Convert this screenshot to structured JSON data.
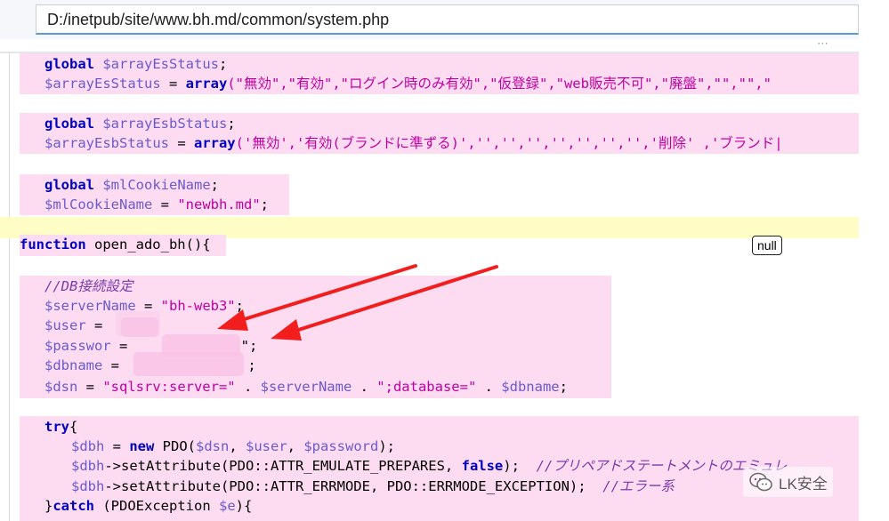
{
  "address_bar": {
    "path": "D:/inetpub/site/www.bh.md/common/system.php"
  },
  "toolbar": {
    "more_dots": "⋯"
  },
  "tooltip": {
    "value": "null"
  },
  "watermark": {
    "text": "LK安全",
    "icon": "wechat-icon"
  },
  "code": {
    "l1": {
      "kw": "global",
      "var": "$arrayEsStatus",
      "tail": ";"
    },
    "l2": {
      "var": "$arrayEsStatus",
      "op": " = ",
      "kw": "array",
      "rest": "(\"無効\",\"有効\",\"ログイン時のみ有効\",\"仮登録\",\"web販売不可\",\"廃盤\",\"\",\"\",\""
    },
    "l3": {
      "kw": "global",
      "var": "$arrayEsbStatus",
      "tail": ";"
    },
    "l4": {
      "var": "$arrayEsbStatus",
      "op": " = ",
      "kw": "array",
      "rest": "('無効','有効(ブランドに準ずる)','','','','','','','','削除' ,'ブランド|"
    },
    "l5": {
      "kw": "global",
      "var": "$mlCookieName",
      "tail": ";"
    },
    "l6": {
      "var": "$mlCookieName",
      "op": " = ",
      "str": "\"newbh.md\"",
      "tail": ";"
    },
    "l7": {
      "kw": "function",
      "name": " open_ado_bh(){"
    },
    "l8": {
      "comment": "//DB接続設定"
    },
    "l9": {
      "var": "$serverName",
      "op": " = ",
      "str": "\"bh-web3\"",
      "tail": ";"
    },
    "l10": {
      "var": "$user",
      "op": " = "
    },
    "l11": {
      "var": "$passwor",
      "op": " = ",
      "tail": "\";"
    },
    "l12": {
      "var": "$dbname",
      "op": " = ",
      "tail": ";"
    },
    "l13": {
      "var1": "$dsn",
      "op1": " = ",
      "str1": "\"sqlsrv:server=\"",
      "op2": " . ",
      "var2": "$serverName",
      "op3": " . ",
      "str2": "\";database=\"",
      "op4": " . ",
      "var3": "$dbname",
      "tail": ";"
    },
    "l14": {
      "kw": "try",
      "tail": "{"
    },
    "l15": {
      "var1": "$dbh",
      "op": " = ",
      "kw": "new",
      "mid": " PDO(",
      "var2": "$dsn",
      "c1": ", ",
      "var3": "$user",
      "c2": ", ",
      "var4": "$password",
      "tail": ");"
    },
    "l16": {
      "var": "$dbh",
      "call": "->setAttribute(PDO::ATTR_EMULATE_PREPARES, ",
      "kw": "false",
      "tail": ");  ",
      "comment": "//プリペアドステートメントのエミュレ"
    },
    "l17": {
      "var": "$dbh",
      "call": "->setAttribute(PDO::ATTR_ERRMODE, PDO::ERRMODE_EXCEPTION);  ",
      "comment": "//エラー系"
    },
    "l18": {
      "pre": "}",
      "kw": "catch",
      "mid": " (PDOException ",
      "var": "$e",
      "tail": "){"
    }
  }
}
